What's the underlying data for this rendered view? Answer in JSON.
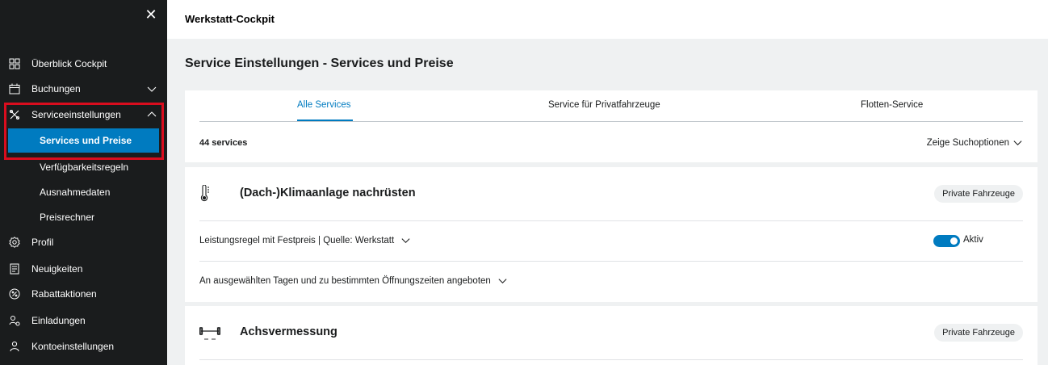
{
  "sidebar": {
    "close_glyph": "✕",
    "items": [
      {
        "label": "Überblick Cockpit",
        "icon": "grid-icon"
      },
      {
        "label": "Buchungen",
        "icon": "calendar-icon"
      },
      {
        "label": "Serviceeinstellungen",
        "icon": "tools-icon"
      },
      {
        "label": "Profil",
        "icon": "gear-icon"
      },
      {
        "label": "Neuigkeiten",
        "icon": "news-icon"
      },
      {
        "label": "Rabattaktionen",
        "icon": "percent-icon"
      },
      {
        "label": "Einladungen",
        "icon": "invite-icon"
      },
      {
        "label": "Kontoeinstellungen",
        "icon": "user-icon"
      }
    ],
    "sub_items": [
      {
        "label": "Services und Preise",
        "active": true
      },
      {
        "label": "Verfügbarkeitsregeln"
      },
      {
        "label": "Ausnahmedaten"
      },
      {
        "label": "Preisrechner"
      }
    ]
  },
  "header": {
    "app_title": "Werkstatt-Cockpit"
  },
  "page": {
    "title": "Service Einstellungen - Services und Preise"
  },
  "tabs": [
    "Alle Services",
    "Service für Privatfahrzeuge",
    "Flotten-Service"
  ],
  "list": {
    "count": "44 services",
    "search_options": "Zeige Suchoptionen"
  },
  "services": [
    {
      "name": "(Dach-)Klimaanlage nachrüsten",
      "icon": "thermometer-icon",
      "badge": "Private Fahrzeuge",
      "rule": "Leistungsregel mit Festpreis | Quelle: Werkstatt",
      "status": "Aktiv",
      "availability": "An ausgewählten Tagen und zu bestimmten Öffnungszeiten angeboten"
    },
    {
      "name": "Achsvermessung",
      "icon": "axle-icon",
      "badge": "Private Fahrzeuge"
    }
  ],
  "colors": {
    "accent": "#007bc0",
    "sidebar": "#1a1c1d",
    "highlight": "#d90d1e"
  }
}
